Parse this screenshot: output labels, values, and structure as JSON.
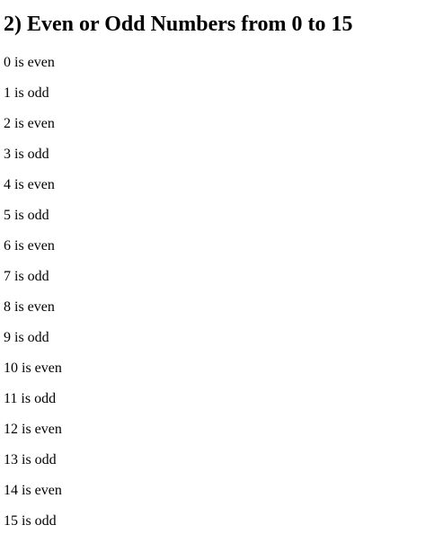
{
  "page": {
    "title": "2) Even or Odd Numbers from 0 to 15",
    "lines": [
      "0 is even",
      "1 is odd",
      "2 is even",
      "3 is odd",
      "4 is even",
      "5 is odd",
      "6 is even",
      "7 is odd",
      "8 is even",
      "9 is odd",
      "10 is even",
      "11 is odd",
      "12 is even",
      "13 is odd",
      "14 is even",
      "15 is odd"
    ]
  }
}
